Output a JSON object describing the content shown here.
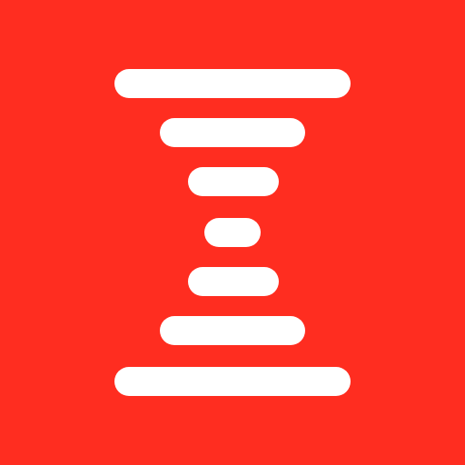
{
  "app_icon": {
    "name": "hourglass-bars-logo-icon",
    "background_color": "#ff2d20",
    "bar_color": "#ffffff",
    "bar_count": 7
  }
}
